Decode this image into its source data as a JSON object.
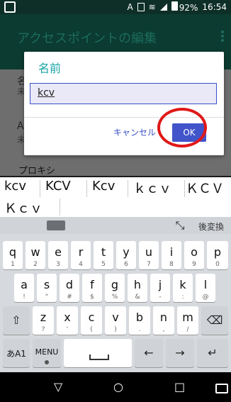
{
  "status_bar": {
    "carrier": "A",
    "battery": "92%",
    "time": "16:54",
    "network": "4G"
  },
  "app": {
    "title": "アクセスポイントの編集",
    "section_label": "プロキシ"
  },
  "dialog": {
    "title": "名前",
    "input_value": "kcv",
    "cancel_label": "キャンセル",
    "ok_label": "OK"
  },
  "suggestions": [
    "kcv",
    "KCV",
    "Kcv",
    "ｋｃｖ",
    "ＫＣＶ",
    "Ｋｃｖ"
  ],
  "keyboard": {
    "toolbar": {
      "convert_label": "後変換"
    },
    "rows": [
      [
        {
          "main": "q",
          "sub": "1"
        },
        {
          "main": "w",
          "sub": "2"
        },
        {
          "main": "e",
          "sub": "3"
        },
        {
          "main": "r",
          "sub": "4"
        },
        {
          "main": "t",
          "sub": "5"
        },
        {
          "main": "y",
          "sub": "6"
        },
        {
          "main": "u",
          "sub": "7"
        },
        {
          "main": "i",
          "sub": "8"
        },
        {
          "main": "o",
          "sub": "9"
        },
        {
          "main": "p",
          "sub": "0"
        }
      ],
      [
        {
          "main": "a",
          "sub": "!"
        },
        {
          "main": "s",
          "sub": "\""
        },
        {
          "main": "d",
          "sub": "#"
        },
        {
          "main": "f",
          "sub": "$"
        },
        {
          "main": "g",
          "sub": "%"
        },
        {
          "main": "h",
          "sub": "&"
        },
        {
          "main": "j",
          "sub": "-"
        },
        {
          "main": "k",
          "sub": ":"
        },
        {
          "main": "l",
          "sub": "@"
        }
      ],
      [
        {
          "main": "z",
          "sub": "?"
        },
        {
          "main": "x",
          "sub": "'"
        },
        {
          "main": "c",
          "sub": "("
        },
        {
          "main": "v",
          "sub": ")"
        },
        {
          "main": "b",
          "sub": "."
        },
        {
          "main": "n",
          "sub": ","
        },
        {
          "main": "m",
          "sub": "/"
        }
      ]
    ],
    "bottom": {
      "ime_label": "あA1",
      "menu_label": "MENU"
    }
  }
}
